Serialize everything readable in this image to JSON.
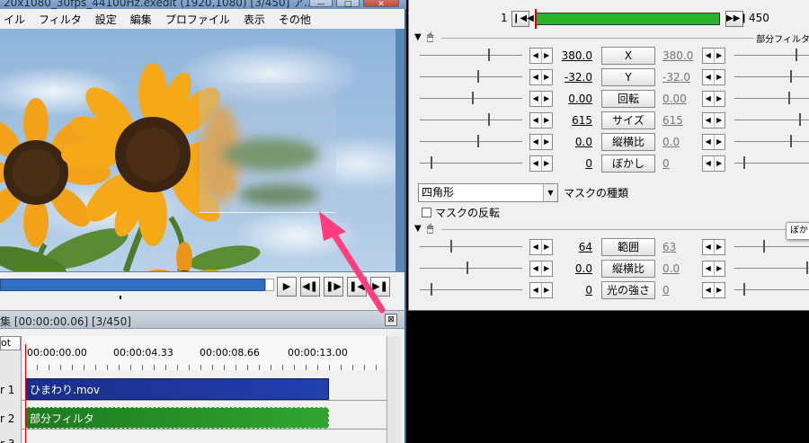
{
  "main_window": {
    "title": "20x1080_30fps_44100Hz.exedit (1920,1080)  [3/450]  ア...",
    "window_buttons": [
      "—",
      "□",
      "✕"
    ],
    "menu": [
      "イル",
      "フィルタ",
      "設定",
      "編集",
      "プロファイル",
      "表示",
      "その他"
    ],
    "playback_buttons": [
      "▶",
      "◀❚",
      "❚▶",
      "❚◀",
      "▶❚"
    ]
  },
  "timeline": {
    "title": "集 [00:00:00.06] [3/450]",
    "close_label": "⊠",
    "root_label": "ot",
    "timecodes": [
      "00:00:00.00",
      "00:00:04.33",
      "00:00:08.66",
      "00:00:13.00"
    ],
    "layers": [
      "r 1",
      "r 2",
      "r 3"
    ],
    "clips": {
      "video": "ひまわり.mov",
      "filter": "部分フィルタ"
    }
  },
  "settings": {
    "frame_start": "1",
    "frame_end": "450",
    "frame_prev_button": "❙◀◀",
    "frame_next_button": "▶▶❙",
    "section1_label": "部分フィルタ",
    "params1": [
      {
        "name": "X",
        "start": "380.0",
        "end": "380.0"
      },
      {
        "name": "Y",
        "start": "-32.0",
        "end": "-32.0"
      },
      {
        "name": "回転",
        "start": "0.00",
        "end": "0.00"
      },
      {
        "name": "サイズ",
        "start": "615",
        "end": "615"
      },
      {
        "name": "縦横比",
        "start": "0.0",
        "end": "0.0"
      },
      {
        "name": "ぼかし",
        "start": "0",
        "end": "0"
      }
    ],
    "mask_type_value": "四角形",
    "mask_type_label": "マスクの種類",
    "mask_invert_label": "マスクの反転",
    "section2_tooltip": "ぼか",
    "params2": [
      {
        "name": "範囲",
        "start": "64",
        "end": "63"
      },
      {
        "name": "縦横比",
        "start": "0.0",
        "end": "0.0"
      },
      {
        "name": "光の強さ",
        "start": "0",
        "end": "0"
      }
    ]
  },
  "colors": {
    "accent_arrow": "#ff3d7f",
    "timeline_video_clip": "#1a2d8a",
    "timeline_filter_clip": "#2fa52f",
    "frame_bar": "#2bb42b"
  }
}
